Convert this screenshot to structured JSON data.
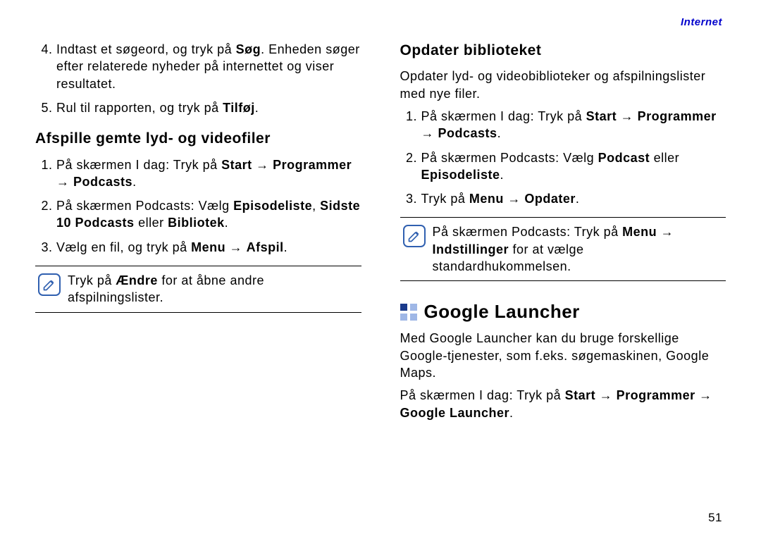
{
  "header": {
    "section": "Internet"
  },
  "left": {
    "list_a": {
      "item4": {
        "pre": "Indtast et søgeord, og tryk på ",
        "bold": "Søg",
        "post": ". Enheden søger efter relaterede nyheder på internettet og viser resultatet."
      },
      "item5": {
        "pre": "Rul til rapporten, og tryk på ",
        "bold": "Tilføj",
        "post": "."
      }
    },
    "subheading": "Afspille gemte lyd- og videofiler",
    "list_b": {
      "item1": {
        "pre": "På skærmen I dag: Tryk på ",
        "b1": "Start",
        "arrow1": " → ",
        "b2": "Programmer",
        "arrow2": " → ",
        "b3": "Podcasts",
        "post": "."
      },
      "item2": {
        "pre": "På skærmen Podcasts: Vælg ",
        "b1": "Episodeliste",
        "mid1": ", ",
        "b2": "Sidste 10 Podcasts",
        "mid2": " eller ",
        "b3": "Bibliotek",
        "post": "."
      },
      "item3": {
        "pre": "Vælg en fil, og tryk på ",
        "b1": "Menu",
        "arrow": " → ",
        "b2": "Afspil",
        "post": "."
      }
    },
    "note": {
      "pre": "Tryk på ",
      "bold": "Ændre",
      "post": " for at åbne andre afspilningslister."
    }
  },
  "right": {
    "subheading": "Opdater biblioteket",
    "intro": "Opdater lyd- og videobiblioteker og afspilningslister med nye filer.",
    "list": {
      "item1": {
        "pre": "På skærmen I dag: Tryk på ",
        "b1": "Start",
        "arrow1": " → ",
        "b2": "Programmer",
        "arrow2": " → ",
        "b3": "Podcasts",
        "post": "."
      },
      "item2": {
        "pre": "På skærmen Podcasts: Vælg ",
        "b1": "Podcast",
        "mid": " eller ",
        "b2": "Episodeliste",
        "post": "."
      },
      "item3": {
        "pre": "Tryk på ",
        "b1": "Menu",
        "arrow": " → ",
        "b2": "Opdater",
        "post": "."
      }
    },
    "note": {
      "pre": "På skærmen Podcasts: Tryk på ",
      "b1": "Menu",
      "arrow": " → ",
      "b2": "Indstillinger",
      "post": " for at vælge standardhukommelsen."
    },
    "section_heading": "Google Launcher",
    "para1": "Med Google Launcher kan du bruge forskellige Google-tjenester, som f.eks. søgemaskinen, Google Maps.",
    "para2": {
      "pre": "På skærmen I dag: Tryk på ",
      "b1": "Start",
      "arrow1": " → ",
      "b2": "Programmer",
      "arrow2": " → ",
      "b3": "Google Launcher",
      "post": "."
    }
  },
  "page_number": "51"
}
